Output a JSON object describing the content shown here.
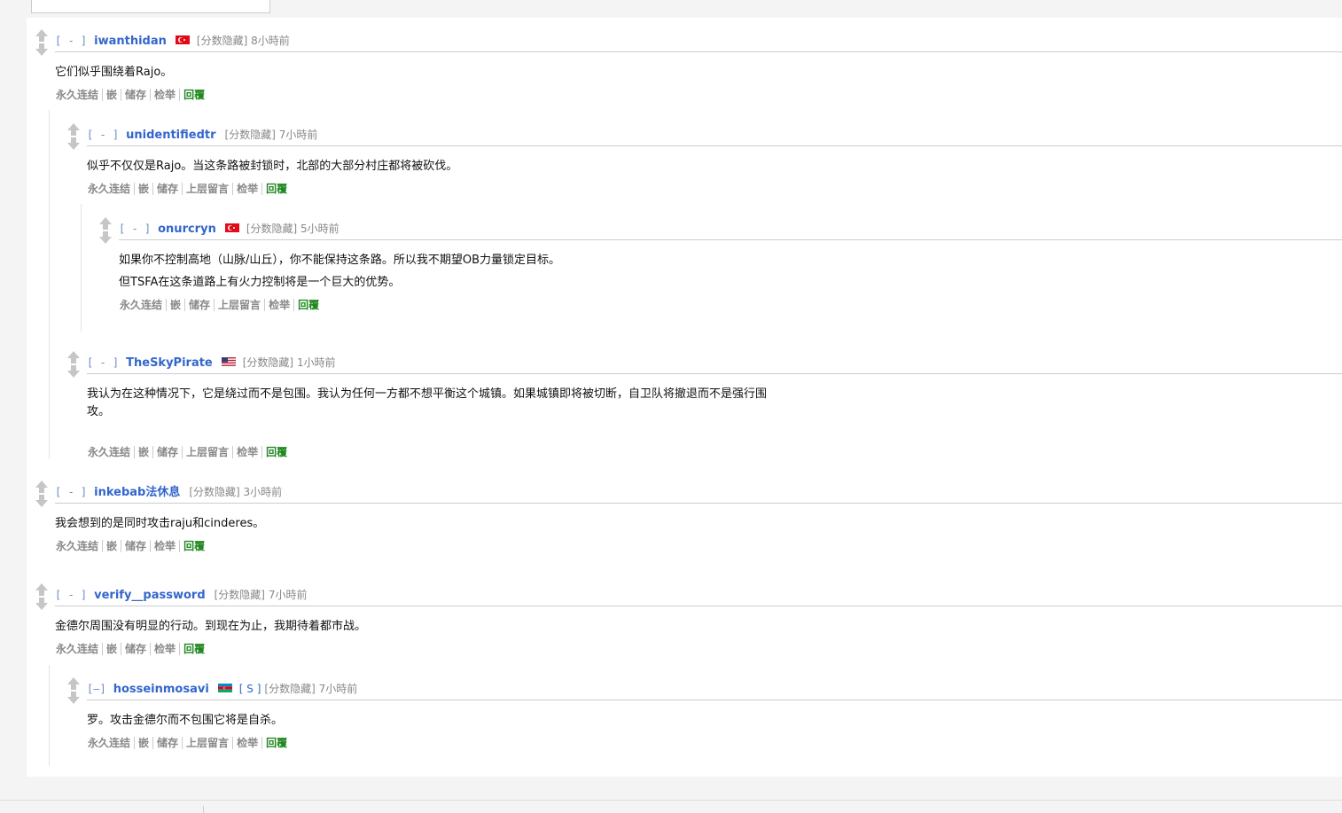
{
  "labels": {
    "collapse": "[ - ]",
    "collapse_alt": "[–]",
    "score_hidden": "[分数隐藏]"
  },
  "comments": [
    {
      "author": "iwanthidan",
      "flag": "tr",
      "time": "8小時前",
      "lines": [
        "它们似乎围绕着Rajo。"
      ],
      "actions": [
        "永久连结",
        "嵌",
        "储存",
        "检举",
        "回覆"
      ]
    },
    {
      "author": "unidentifiedtr",
      "flag": "",
      "time": "7小時前",
      "lines": [
        "似乎不仅仅是Rajo。当这条路被封锁时，北部的大部分村庄都将被砍伐。"
      ],
      "actions": [
        "永久连结",
        "嵌",
        "储存",
        "上层留言",
        "检举",
        "回覆"
      ]
    },
    {
      "author": "onurcryn",
      "flag": "tr",
      "time": "5小時前",
      "lines": [
        "如果你不控制高地（山脉/山丘），你不能保持这条路。所以我不期望OB力量锁定目标。",
        "但TSFA在这条道路上有火力控制将是一个巨大的优势。"
      ],
      "actions": [
        "永久连结",
        "嵌",
        "储存",
        "上层留言",
        "检举",
        "回覆"
      ]
    },
    {
      "author": "TheSkyPirate",
      "flag": "us",
      "time": "1小時前",
      "lines": [
        "我认为在这种情况下，它是绕过而不是包围。我认为任何一方都不想平衡这个城镇。如果城镇即将被切断，自卫队将撤退而不是强行围",
        "攻。"
      ],
      "actions": [
        "永久连结",
        "嵌",
        "储存",
        "上层留言",
        "检举",
        "回覆"
      ]
    },
    {
      "author": "inkebab法休息",
      "flag": "",
      "time": "3小時前",
      "lines": [
        "我会想到的是同时攻击raju和cinderes。"
      ],
      "actions": [
        "永久连结",
        "嵌",
        "储存",
        "检举",
        "回覆"
      ]
    },
    {
      "author": "verify__password",
      "flag": "",
      "time": "7小時前",
      "lines": [
        "金德尔周围没有明显的行动。到现在为止，我期待着都市战。"
      ],
      "actions": [
        "永久连结",
        "嵌",
        "储存",
        "检举",
        "回覆"
      ]
    },
    {
      "author": "hosseinmosavi",
      "flag": "az",
      "submitter_tag": "[ S ]",
      "time": "7小時前",
      "lines": [
        "罗。攻击金德尔而不包围它将是自杀。"
      ],
      "actions": [
        "永久连结",
        "嵌",
        "储存",
        "上层留言",
        "检举",
        "回覆"
      ]
    }
  ]
}
